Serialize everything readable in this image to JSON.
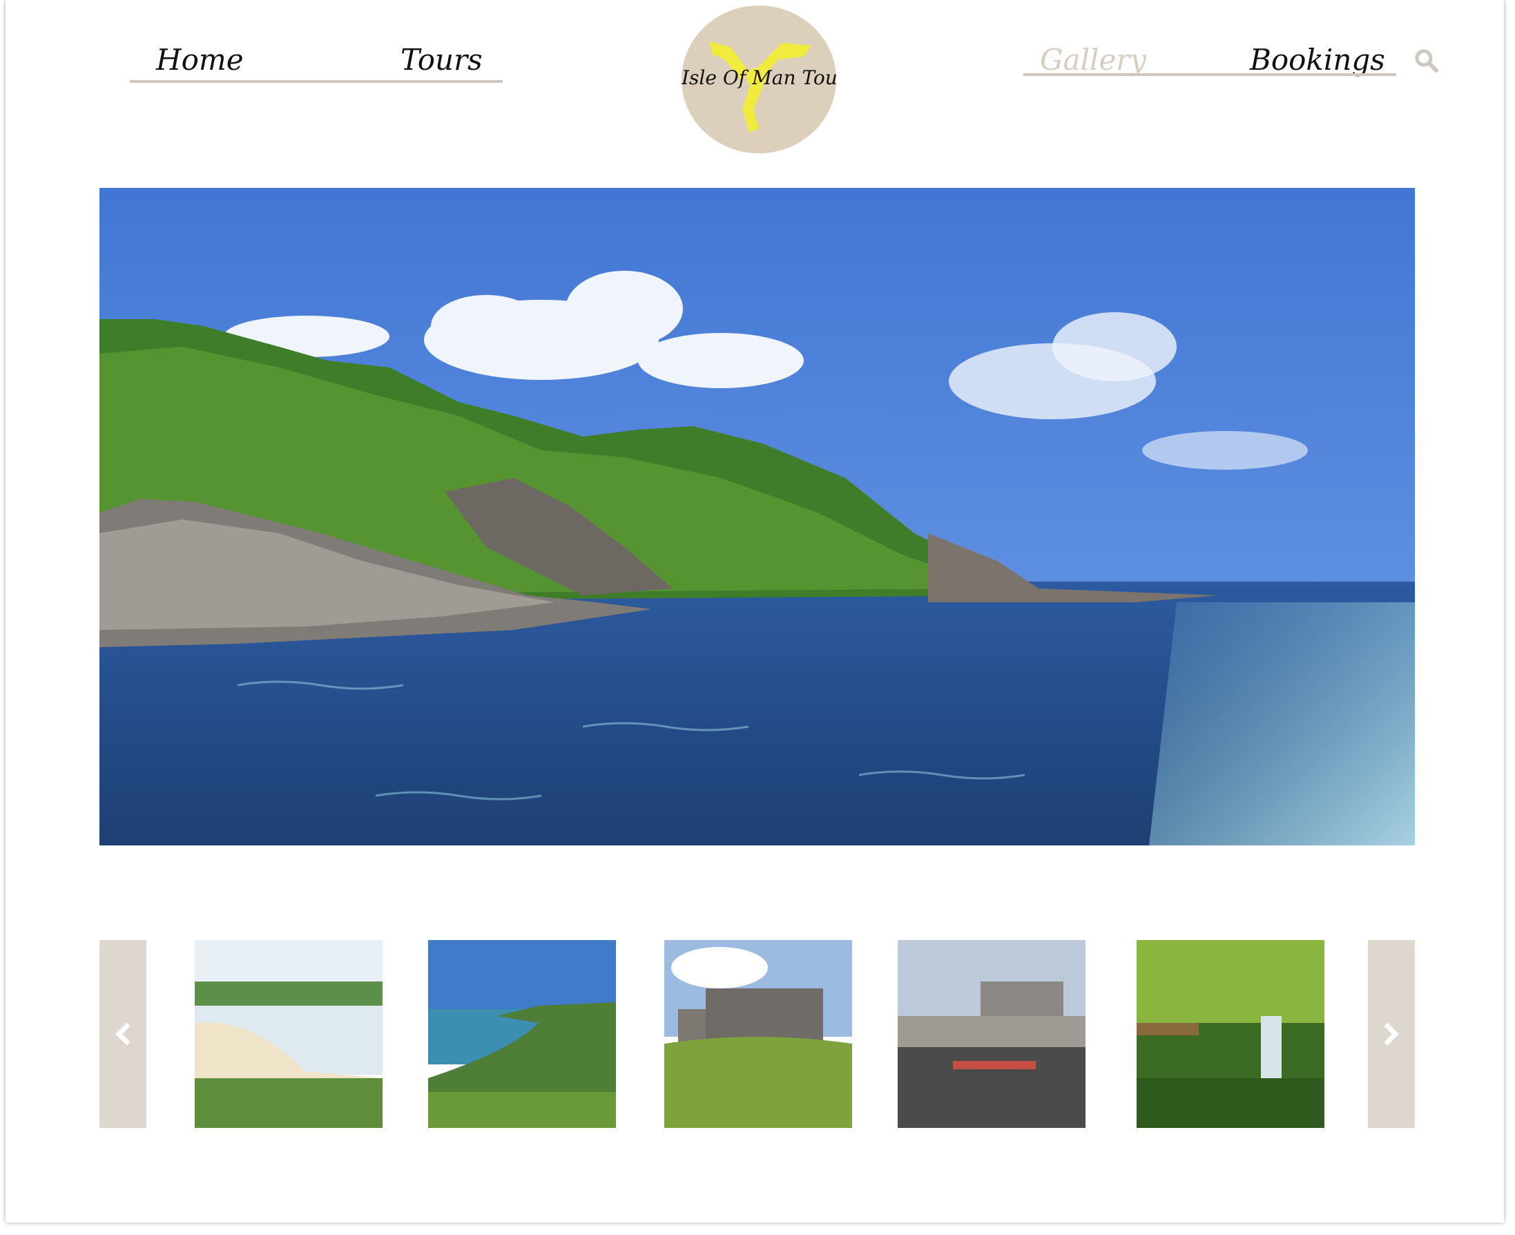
{
  "nav": {
    "left": [
      {
        "label": "Home"
      },
      {
        "label": "Tours"
      }
    ],
    "right": [
      {
        "label": "Gallery",
        "active": true
      },
      {
        "label": "Bookings"
      }
    ],
    "search_icon": "search-icon"
  },
  "logo": {
    "text": "Isle Of Man Tours",
    "icon": "triskelion-icon",
    "background": "#dccfbb",
    "accent": "#f0eb3c"
  },
  "gallery": {
    "hero": {
      "subject": "coastline with green hills, rocks and sea wake"
    },
    "thumbnails": [
      {
        "subject": "sandy beach bay with town"
      },
      {
        "subject": "sea cliffs and headland"
      },
      {
        "subject": "castle-like hotel on grass hill"
      },
      {
        "subject": "harbour with boats and castle"
      },
      {
        "subject": "glen waterfall with wooden railing"
      }
    ],
    "prev_icon": "chevron-left-icon",
    "next_icon": "chevron-right-icon"
  },
  "colors": {
    "underline": "#cfc7bd",
    "active_link": "#d7cdbf",
    "arrow_bg": "#ddd7d0"
  }
}
